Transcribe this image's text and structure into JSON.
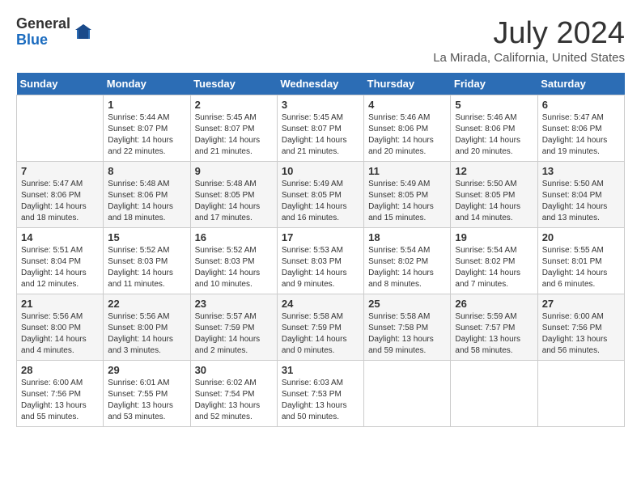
{
  "logo": {
    "general": "General",
    "blue": "Blue"
  },
  "title": "July 2024",
  "subtitle": "La Mirada, California, United States",
  "days_of_week": [
    "Sunday",
    "Monday",
    "Tuesday",
    "Wednesday",
    "Thursday",
    "Friday",
    "Saturday"
  ],
  "weeks": [
    [
      {
        "day": "",
        "sunrise": "",
        "sunset": "",
        "daylight": ""
      },
      {
        "day": "1",
        "sunrise": "Sunrise: 5:44 AM",
        "sunset": "Sunset: 8:07 PM",
        "daylight": "Daylight: 14 hours and 22 minutes."
      },
      {
        "day": "2",
        "sunrise": "Sunrise: 5:45 AM",
        "sunset": "Sunset: 8:07 PM",
        "daylight": "Daylight: 14 hours and 21 minutes."
      },
      {
        "day": "3",
        "sunrise": "Sunrise: 5:45 AM",
        "sunset": "Sunset: 8:07 PM",
        "daylight": "Daylight: 14 hours and 21 minutes."
      },
      {
        "day": "4",
        "sunrise": "Sunrise: 5:46 AM",
        "sunset": "Sunset: 8:06 PM",
        "daylight": "Daylight: 14 hours and 20 minutes."
      },
      {
        "day": "5",
        "sunrise": "Sunrise: 5:46 AM",
        "sunset": "Sunset: 8:06 PM",
        "daylight": "Daylight: 14 hours and 20 minutes."
      },
      {
        "day": "6",
        "sunrise": "Sunrise: 5:47 AM",
        "sunset": "Sunset: 8:06 PM",
        "daylight": "Daylight: 14 hours and 19 minutes."
      }
    ],
    [
      {
        "day": "7",
        "sunrise": "Sunrise: 5:47 AM",
        "sunset": "Sunset: 8:06 PM",
        "daylight": "Daylight: 14 hours and 18 minutes."
      },
      {
        "day": "8",
        "sunrise": "Sunrise: 5:48 AM",
        "sunset": "Sunset: 8:06 PM",
        "daylight": "Daylight: 14 hours and 18 minutes."
      },
      {
        "day": "9",
        "sunrise": "Sunrise: 5:48 AM",
        "sunset": "Sunset: 8:05 PM",
        "daylight": "Daylight: 14 hours and 17 minutes."
      },
      {
        "day": "10",
        "sunrise": "Sunrise: 5:49 AM",
        "sunset": "Sunset: 8:05 PM",
        "daylight": "Daylight: 14 hours and 16 minutes."
      },
      {
        "day": "11",
        "sunrise": "Sunrise: 5:49 AM",
        "sunset": "Sunset: 8:05 PM",
        "daylight": "Daylight: 14 hours and 15 minutes."
      },
      {
        "day": "12",
        "sunrise": "Sunrise: 5:50 AM",
        "sunset": "Sunset: 8:05 PM",
        "daylight": "Daylight: 14 hours and 14 minutes."
      },
      {
        "day": "13",
        "sunrise": "Sunrise: 5:50 AM",
        "sunset": "Sunset: 8:04 PM",
        "daylight": "Daylight: 14 hours and 13 minutes."
      }
    ],
    [
      {
        "day": "14",
        "sunrise": "Sunrise: 5:51 AM",
        "sunset": "Sunset: 8:04 PM",
        "daylight": "Daylight: 14 hours and 12 minutes."
      },
      {
        "day": "15",
        "sunrise": "Sunrise: 5:52 AM",
        "sunset": "Sunset: 8:03 PM",
        "daylight": "Daylight: 14 hours and 11 minutes."
      },
      {
        "day": "16",
        "sunrise": "Sunrise: 5:52 AM",
        "sunset": "Sunset: 8:03 PM",
        "daylight": "Daylight: 14 hours and 10 minutes."
      },
      {
        "day": "17",
        "sunrise": "Sunrise: 5:53 AM",
        "sunset": "Sunset: 8:03 PM",
        "daylight": "Daylight: 14 hours and 9 minutes."
      },
      {
        "day": "18",
        "sunrise": "Sunrise: 5:54 AM",
        "sunset": "Sunset: 8:02 PM",
        "daylight": "Daylight: 14 hours and 8 minutes."
      },
      {
        "day": "19",
        "sunrise": "Sunrise: 5:54 AM",
        "sunset": "Sunset: 8:02 PM",
        "daylight": "Daylight: 14 hours and 7 minutes."
      },
      {
        "day": "20",
        "sunrise": "Sunrise: 5:55 AM",
        "sunset": "Sunset: 8:01 PM",
        "daylight": "Daylight: 14 hours and 6 minutes."
      }
    ],
    [
      {
        "day": "21",
        "sunrise": "Sunrise: 5:56 AM",
        "sunset": "Sunset: 8:00 PM",
        "daylight": "Daylight: 14 hours and 4 minutes."
      },
      {
        "day": "22",
        "sunrise": "Sunrise: 5:56 AM",
        "sunset": "Sunset: 8:00 PM",
        "daylight": "Daylight: 14 hours and 3 minutes."
      },
      {
        "day": "23",
        "sunrise": "Sunrise: 5:57 AM",
        "sunset": "Sunset: 7:59 PM",
        "daylight": "Daylight: 14 hours and 2 minutes."
      },
      {
        "day": "24",
        "sunrise": "Sunrise: 5:58 AM",
        "sunset": "Sunset: 7:59 PM",
        "daylight": "Daylight: 14 hours and 0 minutes."
      },
      {
        "day": "25",
        "sunrise": "Sunrise: 5:58 AM",
        "sunset": "Sunset: 7:58 PM",
        "daylight": "Daylight: 13 hours and 59 minutes."
      },
      {
        "day": "26",
        "sunrise": "Sunrise: 5:59 AM",
        "sunset": "Sunset: 7:57 PM",
        "daylight": "Daylight: 13 hours and 58 minutes."
      },
      {
        "day": "27",
        "sunrise": "Sunrise: 6:00 AM",
        "sunset": "Sunset: 7:56 PM",
        "daylight": "Daylight: 13 hours and 56 minutes."
      }
    ],
    [
      {
        "day": "28",
        "sunrise": "Sunrise: 6:00 AM",
        "sunset": "Sunset: 7:56 PM",
        "daylight": "Daylight: 13 hours and 55 minutes."
      },
      {
        "day": "29",
        "sunrise": "Sunrise: 6:01 AM",
        "sunset": "Sunset: 7:55 PM",
        "daylight": "Daylight: 13 hours and 53 minutes."
      },
      {
        "day": "30",
        "sunrise": "Sunrise: 6:02 AM",
        "sunset": "Sunset: 7:54 PM",
        "daylight": "Daylight: 13 hours and 52 minutes."
      },
      {
        "day": "31",
        "sunrise": "Sunrise: 6:03 AM",
        "sunset": "Sunset: 7:53 PM",
        "daylight": "Daylight: 13 hours and 50 minutes."
      },
      {
        "day": "",
        "sunrise": "",
        "sunset": "",
        "daylight": ""
      },
      {
        "day": "",
        "sunrise": "",
        "sunset": "",
        "daylight": ""
      },
      {
        "day": "",
        "sunrise": "",
        "sunset": "",
        "daylight": ""
      }
    ]
  ]
}
